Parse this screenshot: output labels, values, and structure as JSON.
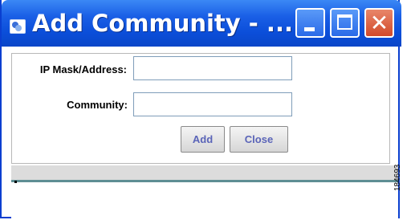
{
  "window": {
    "title": "Add Community - ...",
    "icon": "java-app-icon",
    "controls": {
      "minimize_icon": "minimize-icon",
      "maximize_icon": "maximize-icon",
      "close_icon": "close-icon",
      "close_glyph": "✕"
    },
    "colors": {
      "titlebar": "#0b4ed9",
      "close_button": "#d24a2a",
      "button_text": "#5a64b8",
      "rule": "#5e8e94"
    }
  },
  "form": {
    "ip_label": "IP Mask/Address:",
    "ip_value": "",
    "community_label": "Community:",
    "community_value": "",
    "add_label": "Add",
    "close_label": "Close"
  },
  "figure_number": "184693"
}
